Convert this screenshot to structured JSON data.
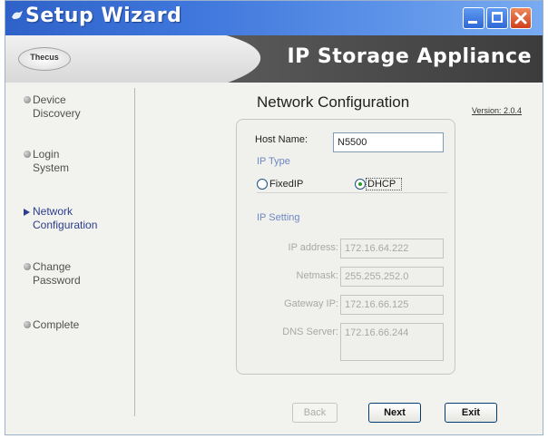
{
  "window": {
    "title": "Setup Wizard",
    "controls": [
      "minimize",
      "maximize",
      "close"
    ]
  },
  "banner": {
    "logo_text": "Thecus",
    "product_name": "IP Storage Appliance"
  },
  "sidebar": {
    "steps": [
      {
        "line1": "Device",
        "line2": "Discovery",
        "active": false
      },
      {
        "line1": "Login",
        "line2": "System",
        "active": false
      },
      {
        "line1": "Network",
        "line2": "Configuration",
        "active": true
      },
      {
        "line1": "Change",
        "line2": "Password",
        "active": false
      },
      {
        "line1": "Complete",
        "line2": "",
        "active": false
      }
    ]
  },
  "main": {
    "heading": "Network Configuration",
    "version": "Version: 2.0.4",
    "host_name": {
      "label": "Host Name:",
      "value": "N5500"
    },
    "ip_type": {
      "label": "IP Type",
      "options": [
        {
          "label": "FixedIP",
          "selected": false
        },
        {
          "label": "DHCP",
          "selected": true
        }
      ]
    },
    "ip_setting": {
      "label": "IP Setting",
      "fields": {
        "ip_address": {
          "label": "IP address:",
          "value": "172.16.64.222"
        },
        "netmask": {
          "label": "Netmask:",
          "value": "255.255.252.0"
        },
        "gateway": {
          "label": "Gateway IP:",
          "value": "172.16.66.125"
        },
        "dns": {
          "label": "DNS Server:",
          "value": "172.16.66.244"
        }
      }
    }
  },
  "buttons": {
    "back": "Back",
    "next": "Next",
    "exit": "Exit"
  },
  "colors": {
    "titlebar": "#3f77dc",
    "close_button": "#cf3f1a",
    "active_step": "#2b3e8c",
    "radio_dot": "#21a121"
  }
}
